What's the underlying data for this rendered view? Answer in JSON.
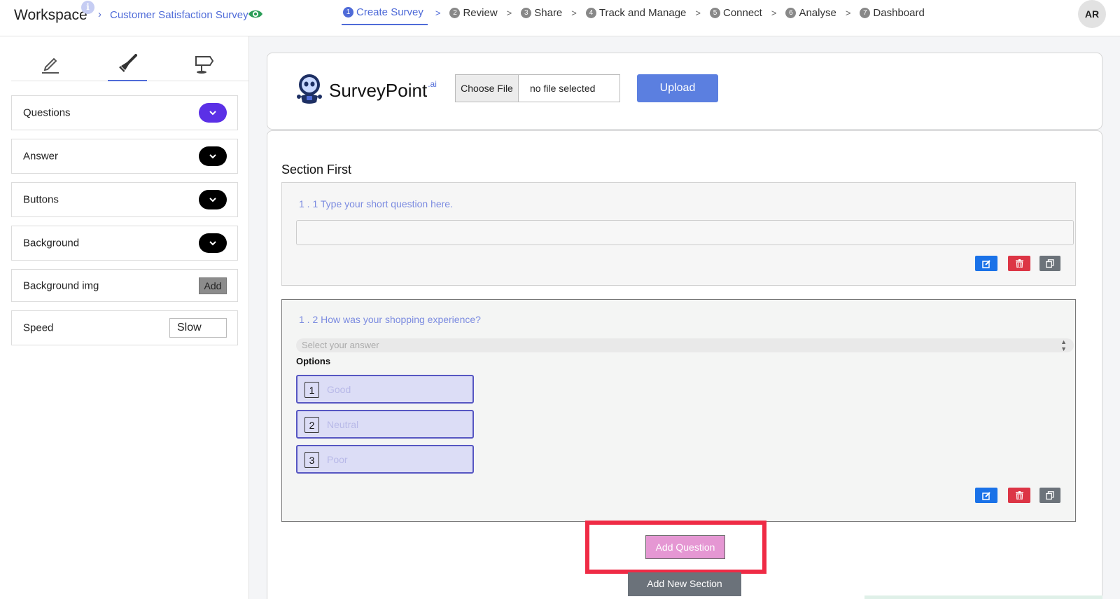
{
  "topbar": {
    "workspace": "Workspace",
    "info_glyph": "i",
    "crumb_sep": "›",
    "survey_name": "Customer Satisfaction Survey",
    "steps": [
      {
        "num": "1",
        "label": "Create Survey"
      },
      {
        "num": "2",
        "label": "Review"
      },
      {
        "num": "3",
        "label": "Share"
      },
      {
        "num": "4",
        "label": "Track and Manage"
      },
      {
        "num": "5",
        "label": "Connect"
      },
      {
        "num": "6",
        "label": "Analyse"
      },
      {
        "num": "7",
        "label": "Dashboard"
      }
    ],
    "avatar": "AR"
  },
  "panel": {
    "tab_icons": [
      "pencil-icon",
      "brush-icon",
      "signpost-icon"
    ],
    "rows": {
      "questions": "Questions",
      "answer": "Answer",
      "buttons": "Buttons",
      "background": "Background",
      "background_img": "Background img",
      "add": "Add",
      "speed": "Speed",
      "speed_value": "Slow"
    }
  },
  "header": {
    "brand": "SurveyPoint",
    "brand_suffix": ".ai",
    "choose_file": "Choose File",
    "no_file": "no file selected",
    "upload": "Upload"
  },
  "survey": {
    "section_title": "Section First",
    "q1": {
      "text": "1 . 1 Type your short question here."
    },
    "q2": {
      "text": "1 . 2 How was your shopping experience?",
      "select_placeholder": "Select your answer",
      "options_label": "Options",
      "options": [
        {
          "n": "1",
          "label": "Good"
        },
        {
          "n": "2",
          "label": "Neutral"
        },
        {
          "n": "3",
          "label": "Poor"
        }
      ]
    },
    "add_question": "Add Question",
    "add_section": "Add New Section"
  },
  "colors": {
    "accent": "#4f6bd8",
    "highlight": "#ef2b45",
    "add_question_bg": "#e597d3",
    "delete": "#dc3545",
    "edit": "#1a72e8"
  }
}
